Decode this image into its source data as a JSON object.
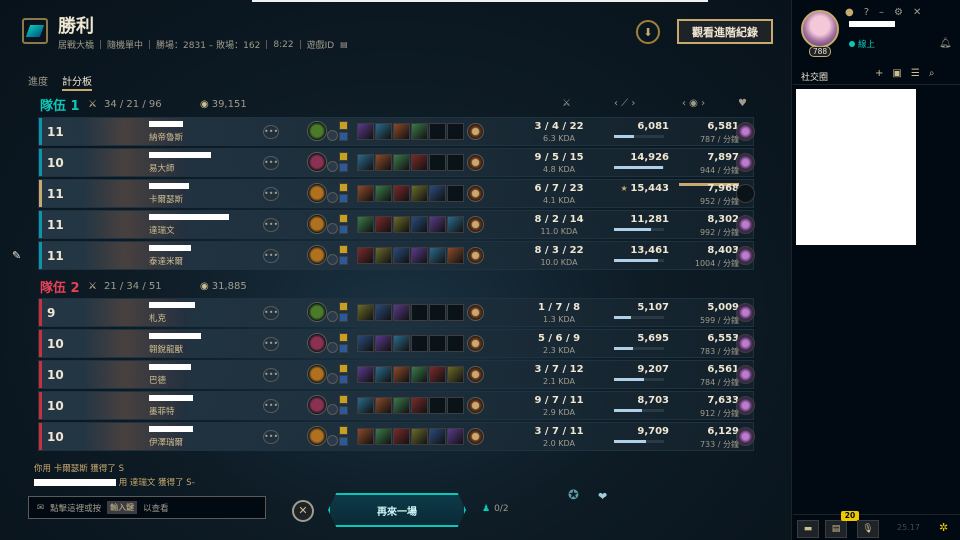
{
  "header": {
    "title": "勝利",
    "meta": [
      "居戰大橋",
      "隨機單中",
      "勝場：2831 – 敗場：162",
      "8:22",
      "遊戲ID"
    ],
    "advanced_button": "觀看進階紀錄"
  },
  "tabs": [
    {
      "label": "進度",
      "active": false
    },
    {
      "label": "計分板",
      "active": true
    }
  ],
  "team1": {
    "name": "隊伍 1",
    "kda": "34 / 21 / 96",
    "gold": "39,151",
    "players": [
      {
        "level": "11",
        "champion": "納帝魯斯",
        "kda": "3 / 4 / 22",
        "ratio": "6.3 KDA",
        "damage": "6,081",
        "damage_pct": 0.39,
        "gold": "6,581",
        "gpm": "787 / 分鐘",
        "honor": true,
        "me": false
      },
      {
        "level": "10",
        "champion": "易大師",
        "kda": "9 / 5 / 15",
        "ratio": "4.8 KDA",
        "damage": "14,926",
        "damage_pct": 0.97,
        "gold": "7,897",
        "gpm": "944 / 分鐘",
        "honor": true,
        "me": false
      },
      {
        "level": "11",
        "champion": "卡爾瑟斯",
        "kda": "6 / 7 / 23",
        "ratio": "4.1 KDA",
        "damage": "15,443",
        "damage_pct": 1.0,
        "gold": "7,968",
        "gpm": "952 / 分鐘",
        "honor": false,
        "me": true
      },
      {
        "level": "11",
        "champion": "達瑞文",
        "kda": "8 / 2 / 14",
        "ratio": "11.0 KDA",
        "damage": "11,281",
        "damage_pct": 0.73,
        "gold": "8,302",
        "gpm": "992 / 分鐘",
        "honor": true,
        "me": false
      },
      {
        "level": "11",
        "champion": "泰達米爾",
        "kda": "8 / 3 / 22",
        "ratio": "10.0 KDA",
        "damage": "13,461",
        "damage_pct": 0.87,
        "gold": "8,403",
        "gpm": "1004 / 分鐘",
        "honor": true,
        "me": false
      }
    ]
  },
  "team2": {
    "name": "隊伍 2",
    "kda": "21 / 34 / 51",
    "gold": "31,885",
    "players": [
      {
        "level": "9",
        "champion": "札克",
        "kda": "1 / 7 / 8",
        "ratio": "1.3 KDA",
        "damage": "5,107",
        "damage_pct": 0.33,
        "gold": "5,009",
        "gpm": "599 / 分鐘",
        "honor": true
      },
      {
        "level": "10",
        "champion": "翱銳龍獸",
        "kda": "5 / 6 / 9",
        "ratio": "2.3 KDA",
        "damage": "5,695",
        "damage_pct": 0.37,
        "gold": "6,553",
        "gpm": "783 / 分鐘",
        "honor": true
      },
      {
        "level": "10",
        "champion": "巴德",
        "kda": "3 / 7 / 12",
        "ratio": "2.1 KDA",
        "damage": "9,207",
        "damage_pct": 0.6,
        "gold": "6,561",
        "gpm": "784 / 分鐘",
        "honor": true
      },
      {
        "level": "10",
        "champion": "墨菲特",
        "kda": "9 / 7 / 11",
        "ratio": "2.9 KDA",
        "damage": "8,703",
        "damage_pct": 0.56,
        "gold": "7,633",
        "gpm": "912 / 分鐘",
        "honor": true
      },
      {
        "level": "10",
        "champion": "伊澤瑞爾",
        "kda": "3 / 7 / 11",
        "ratio": "2.0 KDA",
        "damage": "9,709",
        "damage_pct": 0.63,
        "gold": "6,129",
        "gpm": "733 / 分鐘",
        "honor": true
      }
    ]
  },
  "chat": {
    "line1": "你用 卡爾瑟斯 獲得了 S",
    "line2": "用 達瑞文 獲得了 S-",
    "placeholder_pre": "點擊這裡或按",
    "placeholder_key": "輸入鍵",
    "placeholder_post": "以查看"
  },
  "bottom": {
    "play_again": "再來一場",
    "party": "0/2"
  },
  "sidebar": {
    "level": "788",
    "status": "線上",
    "social_label": "社交圈",
    "badge": "20",
    "version": "25.17"
  },
  "colors": {
    "team1_accent": "#0ac8b9",
    "team2_accent": "#e84057",
    "gold_accent": "#c8aa6e"
  }
}
